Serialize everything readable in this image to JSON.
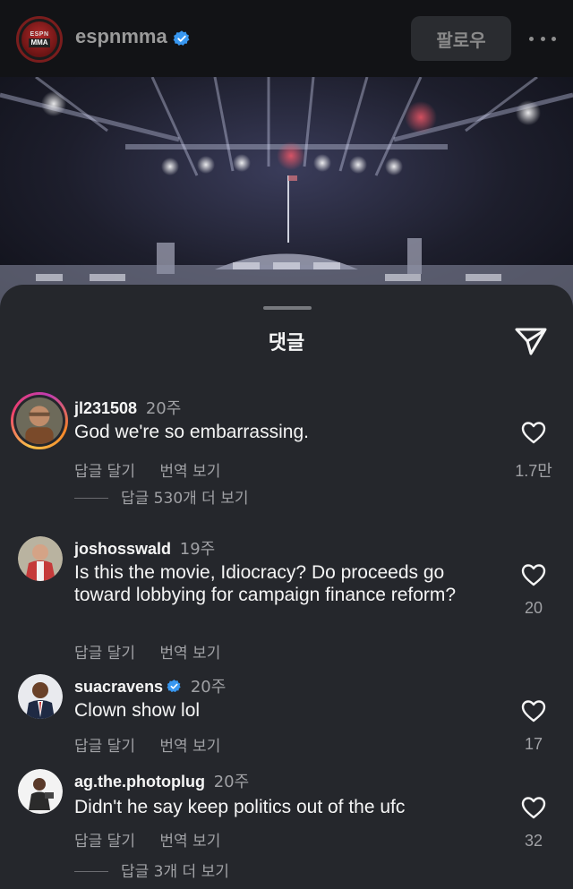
{
  "header": {
    "account_name": "espnmma",
    "avatar_line1": "ESPN",
    "avatar_line2": "MMA",
    "follow_label": "팔로우",
    "more_icon": "more-horizontal-icon",
    "verified_icon": "verified-badge-icon"
  },
  "sheet": {
    "title": "댓글",
    "share_icon": "paper-plane-icon"
  },
  "colors": {
    "sheet_bg": "#25272c",
    "verified_blue": "#3897f0",
    "muted_text": "#a0a1a5"
  },
  "comments": [
    {
      "username": "jl231508",
      "time": "20주",
      "text": "God we're so embarrassing.",
      "reply_label": "답글 달기",
      "translate_label": "번역 보기",
      "likes": "1.7만",
      "view_replies": "답글 530개 더 보기",
      "has_story_ring": true,
      "verified": false
    },
    {
      "username": "joshosswald",
      "time": "19주",
      "text": "Is this the movie, Idiocracy?  Do proceeds go toward lobbying for campaign finance reform?",
      "reply_label": "답글 달기",
      "translate_label": "번역 보기",
      "likes": "20",
      "verified": false
    },
    {
      "username": "suacravens",
      "time": "20주",
      "text": "Clown show lol",
      "reply_label": "답글 달기",
      "translate_label": "번역 보기",
      "likes": "17",
      "verified": true
    },
    {
      "username": "ag.the.photoplug",
      "time": "20주",
      "text": "Didn't he say keep politics out of the ufc",
      "reply_label": "답글 달기",
      "translate_label": "번역 보기",
      "likes": "32",
      "view_replies": "답글 3개 더 보기",
      "verified": false
    }
  ]
}
